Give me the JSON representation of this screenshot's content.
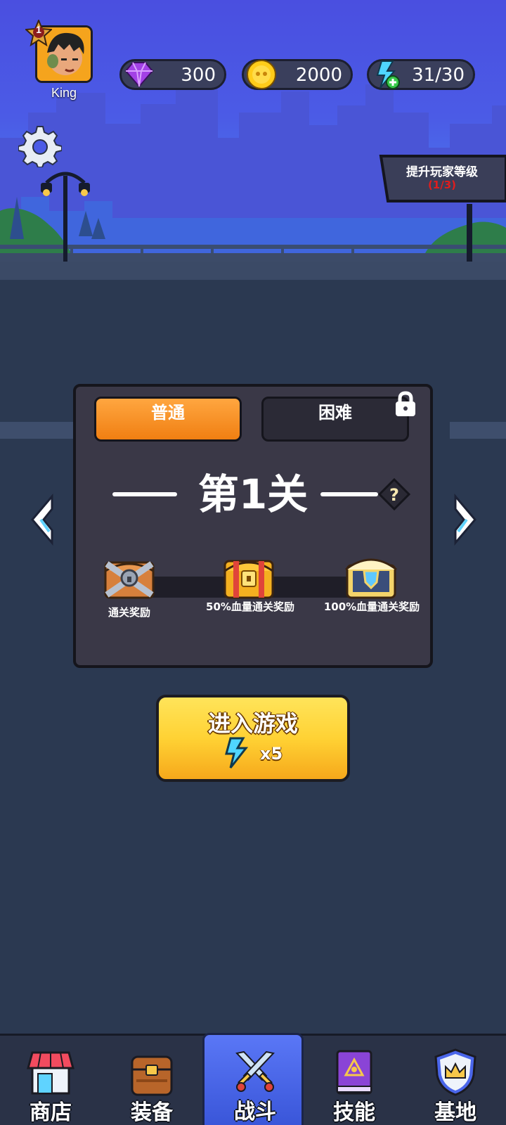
{
  "player": {
    "name": "King",
    "level": "1"
  },
  "resources": {
    "gems": "300",
    "coins": "2000",
    "energy": "31/30"
  },
  "level_up": {
    "title": "提升玩家等级",
    "progress": "(1/3)"
  },
  "stage": {
    "modes": {
      "normal": "普通",
      "hard": "困难"
    },
    "title": "第1关",
    "rewards": [
      {
        "label": "通关奖励",
        "icon": "silver-chest-icon"
      },
      {
        "label": "50%血量通关奖励",
        "icon": "gold-chest-icon"
      },
      {
        "label": "100%血量通关奖励",
        "icon": "royal-chest-icon"
      }
    ]
  },
  "start_button": {
    "label": "进入游戏",
    "cost": "x5"
  },
  "nav": [
    {
      "label": "商店",
      "icon": "shop-icon"
    },
    {
      "label": "装备",
      "icon": "backpack-icon"
    },
    {
      "label": "战斗",
      "icon": "crossed-swords-icon",
      "active": true
    },
    {
      "label": "技能",
      "icon": "spellbook-icon"
    },
    {
      "label": "基地",
      "icon": "crown-shield-icon"
    }
  ],
  "colors": {
    "accent_orange": "#f07f12",
    "start_yellow": "#ffd234",
    "nav_active": "#4a66ea",
    "level_progress_red": "#e11d1d"
  }
}
